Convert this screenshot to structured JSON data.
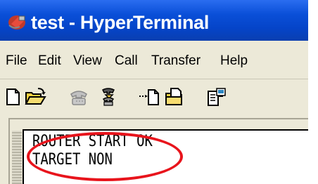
{
  "window": {
    "title": "test - HyperTerminal",
    "app_icon": "hyperterminal-icon"
  },
  "menu": {
    "items": [
      "File",
      "Edit",
      "View",
      "Call",
      "Transfer",
      "Help"
    ]
  },
  "toolbar": {
    "buttons": [
      "new-icon",
      "open-icon",
      "disconnect-icon",
      "call-icon",
      "send-icon",
      "receive-icon",
      "properties-icon"
    ]
  },
  "terminal": {
    "lines": [
      "ROUTER START OK",
      "TARGET NON"
    ]
  },
  "annotation": {
    "color": "#e8141c",
    "shape": "ellipse"
  }
}
